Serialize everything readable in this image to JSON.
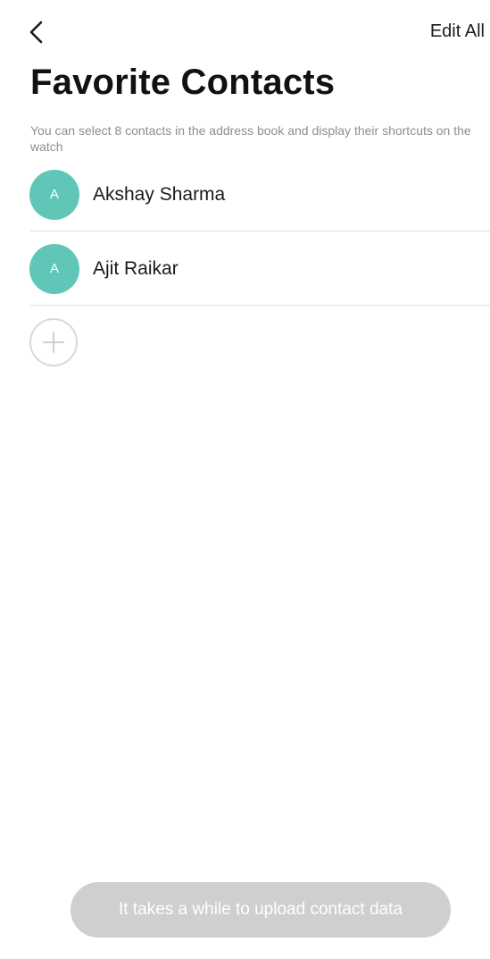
{
  "header": {
    "back_icon": "chevron-left-icon",
    "edit_all_label": "Edit All"
  },
  "page": {
    "title": "Favorite Contacts",
    "subtitle": "You can select 8 contacts in the address book and display their shortcuts on the watch"
  },
  "contacts": [
    {
      "initial": "A",
      "name": "Akshay Sharma"
    },
    {
      "initial": "A",
      "name": "Ajit Raikar"
    }
  ],
  "add_contact": {
    "icon": "plus-icon"
  },
  "footer": {
    "upload_label": "It takes a while to upload contact data"
  },
  "colors": {
    "avatar": "#5fc6b8",
    "divider": "#e2e2e2",
    "disabled_button": "#cfcfcf"
  }
}
